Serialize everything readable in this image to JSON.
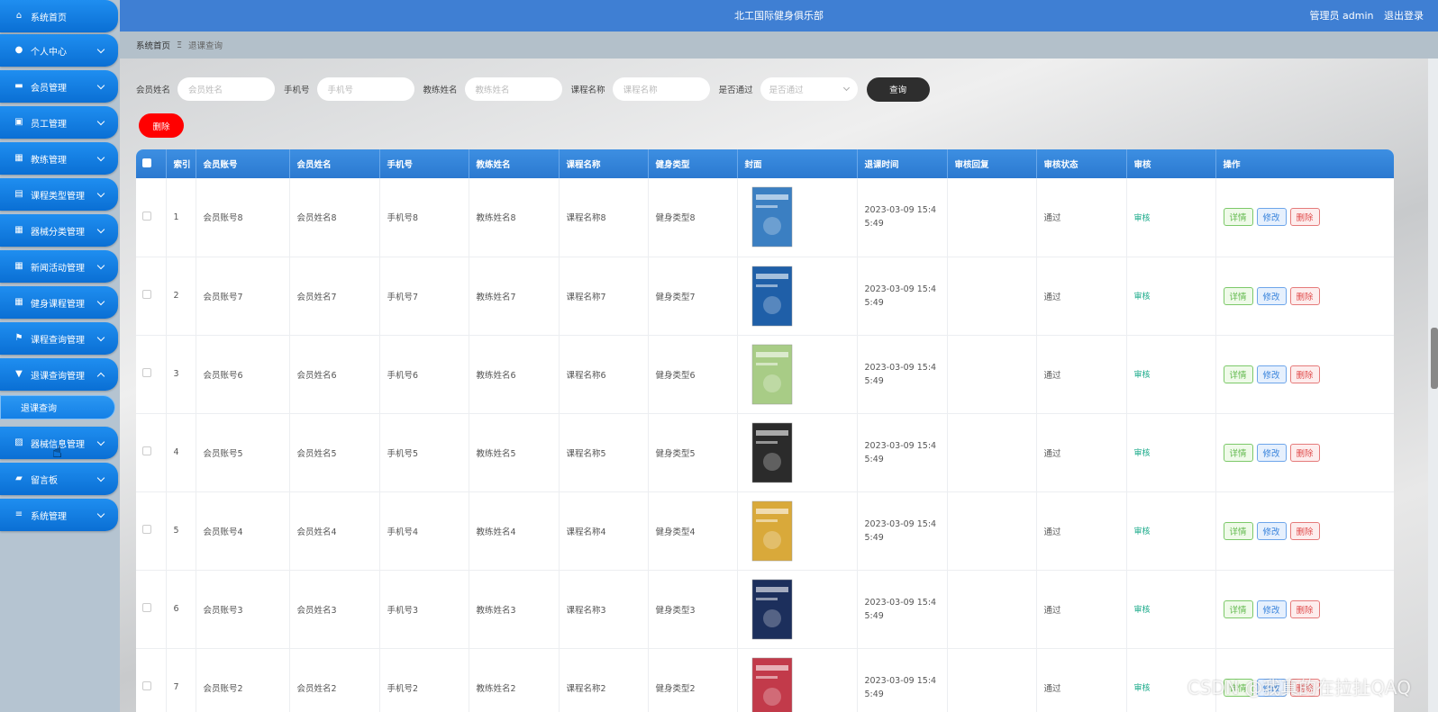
{
  "header": {
    "title": "北工国际健身俱乐部",
    "user": "管理员 admin",
    "logout": "退出登录"
  },
  "breadcrumb": {
    "home": "系统首页",
    "separator": "Ξ",
    "current": "退课查询"
  },
  "sidebar": {
    "items": [
      {
        "label": "系统首页",
        "icon": "home-icon"
      },
      {
        "label": "个人中心",
        "icon": "user-icon"
      },
      {
        "label": "会员管理",
        "icon": "monitor-icon"
      },
      {
        "label": "员工管理",
        "icon": "clipboard-icon"
      },
      {
        "label": "教练管理",
        "icon": "grid-icon"
      },
      {
        "label": "课程类型管理",
        "icon": "table-icon"
      },
      {
        "label": "器械分类管理",
        "icon": "grid-icon"
      },
      {
        "label": "新闻活动管理",
        "icon": "grid-icon"
      },
      {
        "label": "健身课程管理",
        "icon": "grid-icon"
      },
      {
        "label": "课程查询管理",
        "icon": "flag-icon"
      },
      {
        "label": "退课查询管理",
        "icon": "comment-icon"
      },
      {
        "label": "器械信息管理",
        "icon": "chart-icon"
      },
      {
        "label": "留言板",
        "icon": "thumb-icon"
      },
      {
        "label": "系统管理",
        "icon": "menu-icon"
      }
    ],
    "submenu": {
      "label": "退课查询"
    }
  },
  "search": {
    "fields": [
      {
        "label": "会员姓名",
        "placeholder": "会员姓名"
      },
      {
        "label": "手机号",
        "placeholder": "手机号"
      },
      {
        "label": "教练姓名",
        "placeholder": "教练姓名"
      },
      {
        "label": "课程名称",
        "placeholder": "课程名称"
      }
    ],
    "select": {
      "label": "是否通过",
      "placeholder": "是否通过"
    },
    "query_button": "查询",
    "delete_button": "删除"
  },
  "table": {
    "columns": [
      "索引",
      "会员账号",
      "会员姓名",
      "手机号",
      "教练姓名",
      "课程名称",
      "健身类型",
      "封面",
      "退课时间",
      "审核回复",
      "审核状态",
      "审核",
      "操作"
    ],
    "rows": [
      {
        "index": "1",
        "account": "会员账号8",
        "name": "会员姓名8",
        "phone": "手机号8",
        "coach": "教练姓名8",
        "course": "课程名称8",
        "type": "健身类型8",
        "time": "2023-03-09 15:45:49",
        "reply": "",
        "status": "通过",
        "audit": "审核",
        "cover_color": "#3b7fc2"
      },
      {
        "index": "2",
        "account": "会员账号7",
        "name": "会员姓名7",
        "phone": "手机号7",
        "coach": "教练姓名7",
        "course": "课程名称7",
        "type": "健身类型7",
        "time": "2023-03-09 15:45:49",
        "reply": "",
        "status": "通过",
        "audit": "审核",
        "cover_color": "#1f5fa8"
      },
      {
        "index": "3",
        "account": "会员账号6",
        "name": "会员姓名6",
        "phone": "手机号6",
        "coach": "教练姓名6",
        "course": "课程名称6",
        "type": "健身类型6",
        "time": "2023-03-09 15:45:49",
        "reply": "",
        "status": "通过",
        "audit": "审核",
        "cover_color": "#a8cc86"
      },
      {
        "index": "4",
        "account": "会员账号5",
        "name": "会员姓名5",
        "phone": "手机号5",
        "coach": "教练姓名5",
        "course": "课程名称5",
        "type": "健身类型5",
        "time": "2023-03-09 15:45:49",
        "reply": "",
        "status": "通过",
        "audit": "审核",
        "cover_color": "#2b2b2b"
      },
      {
        "index": "5",
        "account": "会员账号4",
        "name": "会员姓名4",
        "phone": "手机号4",
        "coach": "教练姓名4",
        "course": "课程名称4",
        "type": "健身类型4",
        "time": "2023-03-09 15:45:49",
        "reply": "",
        "status": "通过",
        "audit": "审核",
        "cover_color": "#d9a93a"
      },
      {
        "index": "6",
        "account": "会员账号3",
        "name": "会员姓名3",
        "phone": "手机号3",
        "coach": "教练姓名3",
        "course": "课程名称3",
        "type": "健身类型3",
        "time": "2023-03-09 15:45:49",
        "reply": "",
        "status": "通过",
        "audit": "审核",
        "cover_color": "#1c2f5c"
      },
      {
        "index": "7",
        "account": "会员账号2",
        "name": "会员姓名2",
        "phone": "手机号2",
        "coach": "教练姓名2",
        "course": "课程名称2",
        "type": "健身类型2",
        "time": "2023-03-09 15:45:49",
        "reply": "",
        "status": "通过",
        "audit": "审核",
        "cover_color": "#c23a4a"
      }
    ],
    "ops": {
      "detail": "详情",
      "edit": "修改",
      "delete": "删除"
    }
  },
  "watermark": "CSDN @我真的在拉扯QAQ"
}
